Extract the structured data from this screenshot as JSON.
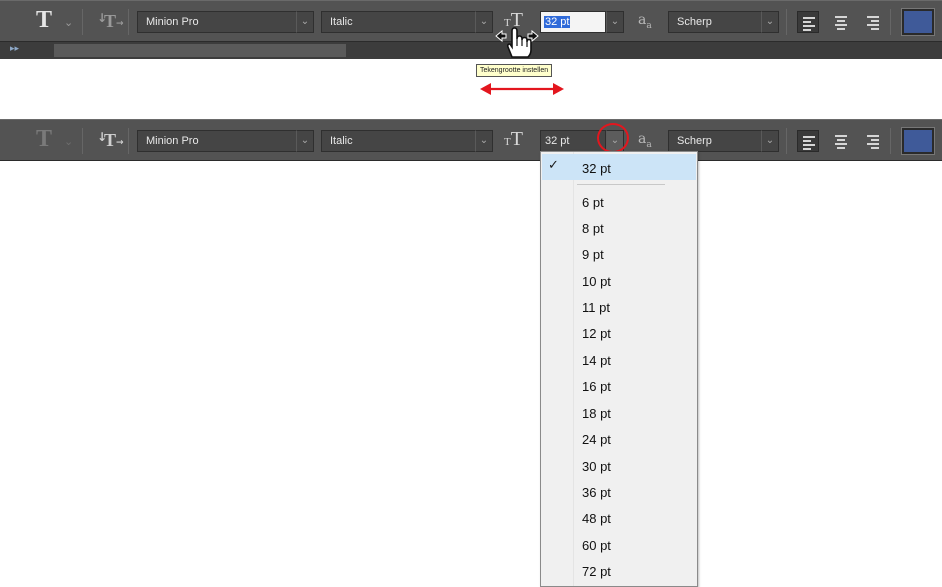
{
  "toolbar_top": {
    "font_family": "Minion Pro",
    "font_style": "Italic",
    "font_size": "32 pt",
    "anti_alias": "Scherp",
    "text_color": "#3f5a99"
  },
  "tooltip": "Tekengrootte instellen",
  "toolbar_bottom": {
    "font_family": "Minion Pro",
    "font_style": "Italic",
    "font_size": "32 pt",
    "anti_alias": "Scherp",
    "text_color": "#3f5a99"
  },
  "size_menu": {
    "selected": "32 pt",
    "options": [
      "6 pt",
      "8 pt",
      "9 pt",
      "10 pt",
      "11 pt",
      "12 pt",
      "14 pt",
      "16 pt",
      "18 pt",
      "24 pt",
      "30 pt",
      "36 pt",
      "48 pt",
      "60 pt",
      "72 pt"
    ]
  },
  "icons": {
    "tool": "type-tool-icon",
    "orientation": "toggle-text-orientation-icon",
    "size": "font-size-icon",
    "antialias": "anti-alias-icon",
    "align_left": "align-left-icon",
    "align_center": "align-center-icon",
    "align_right": "align-right-icon",
    "cursor": "hand-scrub-cursor-icon"
  },
  "colors": {
    "annotation_red": "#e3161e",
    "selection_blue": "#2f6ad9",
    "menu_check_bg": "#cce4f7"
  }
}
